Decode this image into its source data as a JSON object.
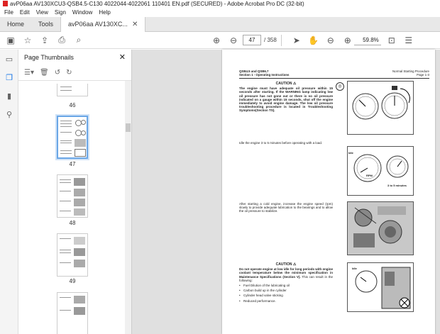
{
  "window": {
    "title": "avP06aa AV130XCU3-QSB4.5-C130 4022044-4022061 110401 EN.pdf (SECURED) - Adobe Acrobat Pro DC (32-bit)"
  },
  "menu": [
    "File",
    "Edit",
    "View",
    "Sign",
    "Window",
    "Help"
  ],
  "tabs": {
    "home": "Home",
    "tools": "Tools",
    "doc": "avP06aa AV130XC..."
  },
  "toolbar": {
    "current_page": "47",
    "page_count": "/ 358",
    "zoom": "59.8%"
  },
  "thumbnails": {
    "title": "Page Thumbnails",
    "pages": [
      "46",
      "47",
      "48",
      "49"
    ]
  },
  "page": {
    "header_left_1": "QSB4.5 and QSB6.7",
    "header_left_2": "Section 1 - Operating Instructions",
    "header_right_1": "Normal Starting Procedure",
    "header_right_2": "Page 1-3",
    "caution_label": "CAUTION",
    "caution1": "The engine must have adequate oil pressure within 15 seconds after starting. If the WARNING lamp indicating low oil pressure has not gone out or there is no oil pressure indicated on a gauge within 15 seconds, shut off the engine immediately to avoid engine damage. The low oil pressure troubleshooting procedure is located in Troubleshooting Symptoms(Section TS).",
    "idle_text": "Idle the engine 3 to 5 minutes before operating with a load.",
    "cold_text": "After starting a cold engine, increase the engine speed (rpm) slowly to provide adequate lubrication to the bearings and to allow the oil pressure to stabilize.",
    "caution2_bold": "Do not operate engine at low idle for long periods with engine coolant temperature below the minimum specification in Maintenance Specifications (Section V).",
    "caution2_rest": " This can result in the following:",
    "bullets": [
      "Fuel Dilution of the lubricating oil",
      "Carbon build up in the cylinder",
      "Cylinder head valve sticking",
      "Reduced performance."
    ],
    "fig2_label": "3 to 5 minutes",
    "fig2_idle": "Idle",
    "fig2_rpm": "RPM",
    "fig4_idle": "Idle"
  }
}
